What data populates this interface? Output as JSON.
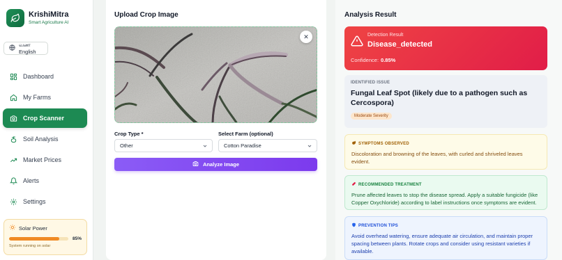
{
  "brand": {
    "name": "KrishiMitra",
    "subtitle": "Smart Agriculture AI",
    "icon": "leaf-icon"
  },
  "language": {
    "icon": "globe-icon",
    "label": "வண English"
  },
  "nav": {
    "items": [
      {
        "label": "Dashboard",
        "icon": "dashboard-icon"
      },
      {
        "label": "My Farms",
        "icon": "home-icon"
      },
      {
        "label": "Crop Scanner",
        "icon": "camera-icon",
        "active": true
      },
      {
        "label": "Soil Analysis",
        "icon": "soil-icon"
      },
      {
        "label": "Market Prices",
        "icon": "trend-icon"
      },
      {
        "label": "Alerts",
        "icon": "bell-icon"
      },
      {
        "label": "Settings",
        "icon": "gear-icon"
      }
    ]
  },
  "solar": {
    "title": "Solar Power",
    "percent": 85,
    "percent_label": "85%",
    "status": "System running on solar"
  },
  "upload": {
    "title": "Upload Crop Image",
    "close_icon": "close-icon",
    "crop_type_label": "Crop Type *",
    "crop_type_value": "Other",
    "farm_label": "Select Farm (optional)",
    "farm_value": "Cotton Paradise",
    "analyze_label": "Analyze Image"
  },
  "result": {
    "title": "Analysis Result",
    "detection_label": "Detection Result",
    "detection_value": "Disease_detected",
    "confidence_label": "Confidence:",
    "confidence_value": "0.85%",
    "issue": {
      "header": "IDENTIFIED ISSUE",
      "title": "Fungal Leaf Spot (likely due to a pathogen such as Cercospora)",
      "severity": "Moderate Severity"
    },
    "symptoms": {
      "header": "SYMPTOMS OBSERVED",
      "text": "Discoloration and browning of the leaves, with curled and shriveled leaves evident."
    },
    "treatment": {
      "header": "RECOMMENDED TREATMENT",
      "text": "Prune affected leaves to stop the disease spread. Apply a suitable fungicide (like Copper Oxychloride) according to label instructions once symptoms are evident."
    },
    "prevention": {
      "header": "PREVENTION TIPS",
      "text": "Avoid overhead watering, ensure adequate air circulation, and maintain proper spacing between plants. Rotate crops and consider using resistant varieties if available."
    }
  },
  "colors": {
    "primary_green": "#1d8a53",
    "detect_red": "#ef4444",
    "analyze_purple": "#7c3aed",
    "solar_orange": "#f08a24"
  }
}
